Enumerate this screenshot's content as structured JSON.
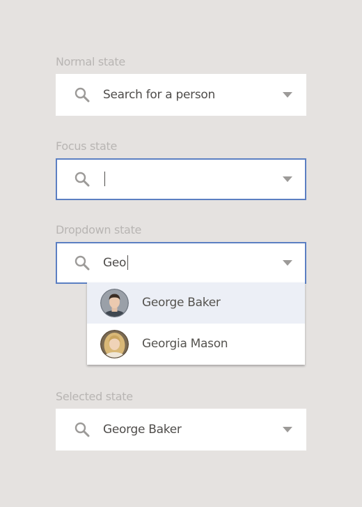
{
  "normal": {
    "label": "Normal state",
    "value": "Search for a person"
  },
  "focus": {
    "label": "Focus state",
    "value": ""
  },
  "dropdown": {
    "label": "Dropdown state",
    "value": "Geo",
    "options": [
      {
        "name": "George Baker",
        "avatar": "male-avatar-icon"
      },
      {
        "name": "Georgia Mason",
        "avatar": "female-avatar-icon"
      }
    ]
  },
  "selected": {
    "label": "Selected state",
    "value": "George Baker"
  },
  "colors": {
    "background": "#e5e2e0",
    "label": "#b8b5b3",
    "focus_border": "#5b7fc2",
    "option_highlight": "#eceff6",
    "text": "#4f4d4b",
    "icon": "#9c9a98"
  }
}
